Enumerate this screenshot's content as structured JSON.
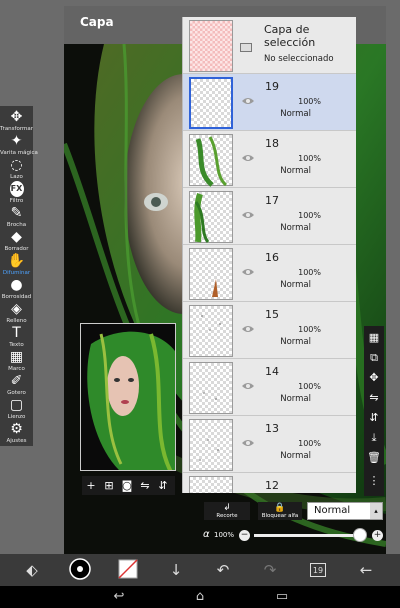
{
  "dialog": {
    "title": "Capa"
  },
  "tools": [
    {
      "label": "Transformar",
      "icon": "move-arrows-icon",
      "glyph": "✥"
    },
    {
      "label": "Varita mágica",
      "icon": "magic-wand-icon",
      "glyph": "✦"
    },
    {
      "label": "Lazo",
      "icon": "lasso-icon",
      "glyph": "◌"
    },
    {
      "label": "Filtro",
      "icon": "fx-icon",
      "glyph": "FX"
    },
    {
      "label": "Brocha",
      "icon": "brush-icon",
      "glyph": "✎"
    },
    {
      "label": "Borrador",
      "icon": "eraser-icon",
      "glyph": "◆"
    },
    {
      "label": "Difuminar",
      "icon": "smudge-icon",
      "glyph": "✋",
      "active": true
    },
    {
      "label": "Borrosidad",
      "icon": "blur-drop-icon",
      "glyph": "●"
    },
    {
      "label": "Relleno",
      "icon": "fill-bucket-icon",
      "glyph": "◈"
    },
    {
      "label": "Texto",
      "icon": "text-icon",
      "glyph": "T"
    },
    {
      "label": "Marco",
      "icon": "frame-icon",
      "glyph": "▦"
    },
    {
      "label": "Gotero",
      "icon": "eyedropper-icon",
      "glyph": "✐"
    },
    {
      "label": "Lienzo",
      "icon": "canvas-icon",
      "glyph": "▢"
    },
    {
      "label": "Ajustes",
      "icon": "gear-icon",
      "glyph": "⚙"
    }
  ],
  "selection_layer": {
    "title": "Capa de selección",
    "status": "No seleccionado"
  },
  "layers": [
    {
      "number": "19",
      "opacity": "100%",
      "blend": "Normal",
      "selected": true
    },
    {
      "number": "18",
      "opacity": "100%",
      "blend": "Normal",
      "selected": false
    },
    {
      "number": "17",
      "opacity": "100%",
      "blend": "Normal",
      "selected": false
    },
    {
      "number": "16",
      "opacity": "100%",
      "blend": "Normal",
      "selected": false
    },
    {
      "number": "15",
      "opacity": "100%",
      "blend": "Normal",
      "selected": false
    },
    {
      "number": "14",
      "opacity": "100%",
      "blend": "Normal",
      "selected": false
    },
    {
      "number": "13",
      "opacity": "100%",
      "blend": "Normal",
      "selected": false
    },
    {
      "number": "12",
      "opacity": "",
      "blend": "",
      "selected": false
    }
  ],
  "bottom_controls": {
    "clip_label": "Recorte",
    "lock_alpha_label": "Bloquear alfa",
    "blend_mode": "Normal",
    "alpha_symbol": "α",
    "alpha_value": "100%",
    "opacity_fraction": 1.0
  },
  "toolbar": {
    "layer_count": "19"
  },
  "colors": {
    "accent": "#4da3ff",
    "selected_row": "#cfd9ee",
    "selected_border": "#2f62d8"
  }
}
